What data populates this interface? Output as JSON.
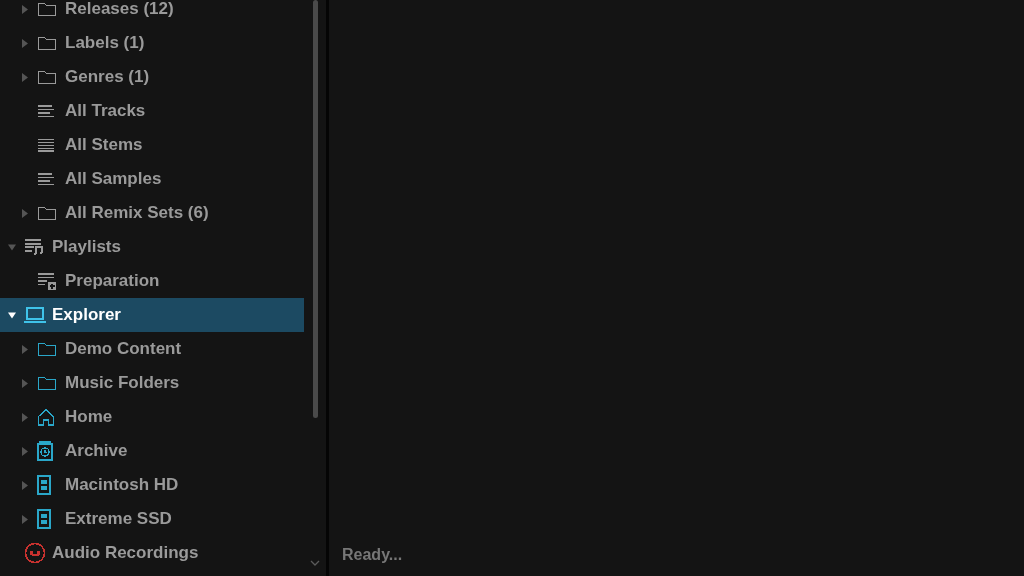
{
  "sidebar": {
    "tree": [
      {
        "children": [
          {
            "label": "Releases (12)",
            "kind": "folder",
            "color": "#9a9a9a",
            "expanded": false
          },
          {
            "label": "Labels (1)",
            "kind": "folder",
            "color": "#9a9a9a",
            "expanded": false
          },
          {
            "label": "Genres (1)",
            "kind": "folder",
            "color": "#9a9a9a",
            "expanded": false
          },
          {
            "label": "All Tracks",
            "kind": "list",
            "color": "#9a9a9a"
          },
          {
            "label": "All Stems",
            "kind": "list-dense",
            "color": "#9a9a9a"
          },
          {
            "label": "All Samples",
            "kind": "list",
            "color": "#9a9a9a"
          },
          {
            "label": "All Remix Sets (6)",
            "kind": "folder",
            "color": "#9a9a9a",
            "expanded": false
          }
        ]
      },
      {
        "label": "Playlists",
        "kind": "playlist",
        "color": "#9a9a9a",
        "expanded": true,
        "selected": false,
        "children": [
          {
            "label": "Preparation",
            "kind": "playlist-add",
            "color": "#9a9a9a",
            "selected": false
          }
        ]
      },
      {
        "label": "Explorer",
        "kind": "laptop",
        "color": "#3fc3ea",
        "expanded": true,
        "selected": true,
        "children": [
          {
            "label": "Demo Content",
            "kind": "folder",
            "color": "#2aa7c9",
            "expanded": false,
            "selected": false
          },
          {
            "label": "Music Folders",
            "kind": "folder",
            "color": "#2aa7c9",
            "expanded": false,
            "selected": false
          },
          {
            "label": "Home",
            "kind": "home",
            "color": "#2aa7c9",
            "expanded": false,
            "selected": false
          },
          {
            "label": "Archive",
            "kind": "archive",
            "color": "#2aa7c9",
            "expanded": false,
            "selected": false
          },
          {
            "label": "Macintosh HD",
            "kind": "drive",
            "color": "#2aa7c9",
            "expanded": false,
            "selected": false
          },
          {
            "label": "Extreme SSD",
            "kind": "drive",
            "color": "#2aa7c9",
            "expanded": false,
            "selected": false
          }
        ]
      },
      {
        "label": "Audio Recordings",
        "kind": "record",
        "color": "#c8322f",
        "selected": false
      }
    ]
  },
  "status_bar": {
    "text": "Ready..."
  }
}
